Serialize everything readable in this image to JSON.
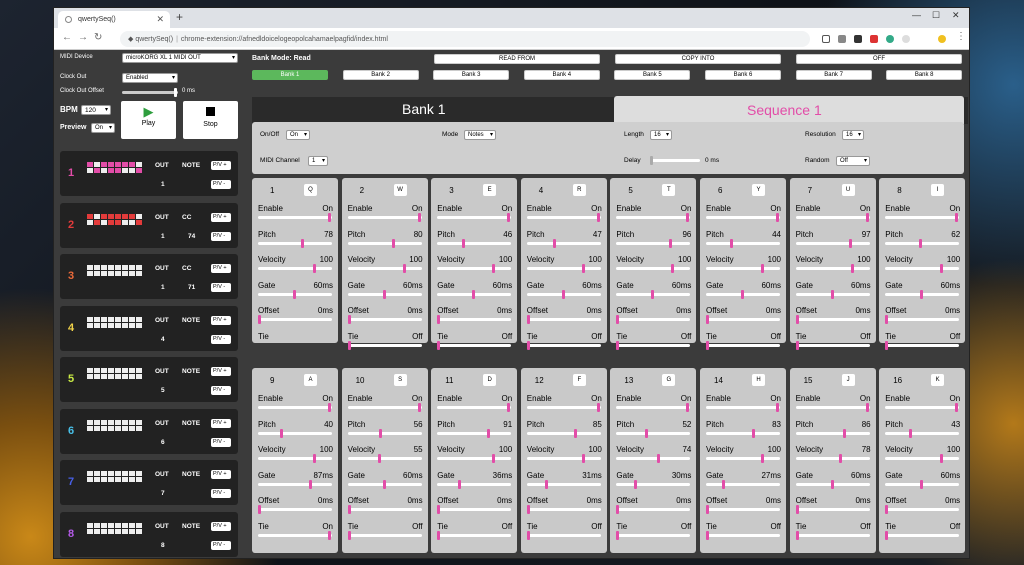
{
  "browser": {
    "tab_title": "qwertySeq()",
    "url_host": "qwertySeq()",
    "url_path": "chrome-extension://afnedldoicelogeopolcahamaelpagfid/index.html"
  },
  "left": {
    "midi_device_label": "MIDI Device",
    "midi_device_value": "microKORG XL 1 MIDI OUT",
    "clock_out_label": "Clock Out",
    "clock_out_value": "Enabled",
    "clock_offset_label": "Clock Out Offset",
    "clock_offset_value": "0 ms",
    "bpm_label": "BPM",
    "bpm_value": "120",
    "preview_label": "Preview",
    "preview_value": "On",
    "play_label": "Play",
    "stop_label": "Stop",
    "tracks": [
      {
        "num": "1",
        "color": "#e24da8",
        "out_label": "OUT",
        "type": "NOTE",
        "out": "1",
        "cc": "",
        "pv1": "P/V +",
        "pv2": "P/V -"
      },
      {
        "num": "2",
        "color": "#e33b3b",
        "out_label": "OUT",
        "type": "CC",
        "out": "1",
        "cc": "74",
        "pv1": "P/V +",
        "pv2": "P/V -"
      },
      {
        "num": "3",
        "color": "#ea6a3a",
        "out_label": "OUT",
        "type": "CC",
        "out": "1",
        "cc": "71",
        "pv1": "P/V +",
        "pv2": "P/V -"
      },
      {
        "num": "4",
        "color": "#f2d34a",
        "out_label": "OUT",
        "type": "NOTE",
        "out": "4",
        "cc": "",
        "pv1": "P/V +",
        "pv2": "P/V -"
      },
      {
        "num": "5",
        "color": "#c8ea44",
        "out_label": "OUT",
        "type": "NOTE",
        "out": "5",
        "cc": "",
        "pv1": "P/V +",
        "pv2": "P/V -"
      },
      {
        "num": "6",
        "color": "#48c0e8",
        "out_label": "OUT",
        "type": "NOTE",
        "out": "6",
        "cc": "",
        "pv1": "P/V +",
        "pv2": "P/V -"
      },
      {
        "num": "7",
        "color": "#4860e8",
        "out_label": "OUT",
        "type": "NOTE",
        "out": "7",
        "cc": "",
        "pv1": "P/V +",
        "pv2": "P/V -"
      },
      {
        "num": "8",
        "color": "#b45ae8",
        "out_label": "OUT",
        "type": "NOTE",
        "out": "8",
        "cc": "",
        "pv1": "P/V +",
        "pv2": "P/V -"
      }
    ]
  },
  "main": {
    "bank_mode": "Bank Mode: Read",
    "read_from": "READ FROM",
    "copy_into": "COPY INTO",
    "off": "OFF",
    "banks": [
      "Bank 1",
      "Bank 2",
      "Bank 3",
      "Bank 4",
      "Bank 5",
      "Bank 6",
      "Bank 7",
      "Bank 8"
    ],
    "active_bank_color": "#5cb85c",
    "bank_title": "Bank 1",
    "sequence_title": "Sequence 1",
    "sequence_color": "#e24da8",
    "onoff_label": "On/Off",
    "onoff_value": "On",
    "mode_label": "Mode",
    "mode_value": "Notes",
    "length_label": "Length",
    "length_value": "16",
    "resolution_label": "Resolution",
    "resolution_value": "16",
    "midi_channel_label": "MIDI Channel",
    "midi_channel_value": "1",
    "delay_label": "Delay",
    "delay_value": "0 ms",
    "random_label": "Random",
    "random_value": "Off",
    "row_labels": {
      "enable": "Enable",
      "pitch": "Pitch",
      "velocity": "Velocity",
      "gate": "Gate",
      "offset": "Offset",
      "tie": "Tie"
    },
    "steps": [
      {
        "n": "1",
        "key": "Q",
        "enable": "On",
        "pitch": "78",
        "velocity": "100",
        "gate": "60ms",
        "offset": "0ms",
        "tie": ""
      },
      {
        "n": "2",
        "key": "W",
        "enable": "On",
        "pitch": "80",
        "velocity": "100",
        "gate": "60ms",
        "offset": "0ms",
        "tie": "Off"
      },
      {
        "n": "3",
        "key": "E",
        "enable": "On",
        "pitch": "46",
        "velocity": "100",
        "gate": "60ms",
        "offset": "0ms",
        "tie": "Off"
      },
      {
        "n": "4",
        "key": "R",
        "enable": "On",
        "pitch": "47",
        "velocity": "100",
        "gate": "60ms",
        "offset": "0ms",
        "tie": "Off"
      },
      {
        "n": "5",
        "key": "T",
        "enable": "On",
        "pitch": "96",
        "velocity": "100",
        "gate": "60ms",
        "offset": "0ms",
        "tie": "Off"
      },
      {
        "n": "6",
        "key": "Y",
        "enable": "On",
        "pitch": "44",
        "velocity": "100",
        "gate": "60ms",
        "offset": "0ms",
        "tie": "Off"
      },
      {
        "n": "7",
        "key": "U",
        "enable": "On",
        "pitch": "97",
        "velocity": "100",
        "gate": "60ms",
        "offset": "0ms",
        "tie": "Off"
      },
      {
        "n": "8",
        "key": "I",
        "enable": "On",
        "pitch": "62",
        "velocity": "100",
        "gate": "60ms",
        "offset": "0ms",
        "tie": "Off"
      },
      {
        "n": "9",
        "key": "A",
        "enable": "On",
        "pitch": "40",
        "velocity": "100",
        "gate": "87ms",
        "offset": "0ms",
        "tie": "On"
      },
      {
        "n": "10",
        "key": "S",
        "enable": "On",
        "pitch": "56",
        "velocity": "55",
        "gate": "60ms",
        "offset": "0ms",
        "tie": "Off"
      },
      {
        "n": "11",
        "key": "D",
        "enable": "On",
        "pitch": "91",
        "velocity": "100",
        "gate": "36ms",
        "offset": "0ms",
        "tie": "Off"
      },
      {
        "n": "12",
        "key": "F",
        "enable": "On",
        "pitch": "85",
        "velocity": "100",
        "gate": "31ms",
        "offset": "0ms",
        "tie": "Off"
      },
      {
        "n": "13",
        "key": "G",
        "enable": "On",
        "pitch": "52",
        "velocity": "74",
        "gate": "30ms",
        "offset": "0ms",
        "tie": "Off"
      },
      {
        "n": "14",
        "key": "H",
        "enable": "On",
        "pitch": "83",
        "velocity": "100",
        "gate": "27ms",
        "offset": "0ms",
        "tie": "Off"
      },
      {
        "n": "15",
        "key": "J",
        "enable": "On",
        "pitch": "86",
        "velocity": "78",
        "gate": "60ms",
        "offset": "0ms",
        "tie": "Off"
      },
      {
        "n": "16",
        "key": "K",
        "enable": "On",
        "pitch": "43",
        "velocity": "100",
        "gate": "60ms",
        "offset": "0ms",
        "tie": "Off"
      }
    ]
  }
}
